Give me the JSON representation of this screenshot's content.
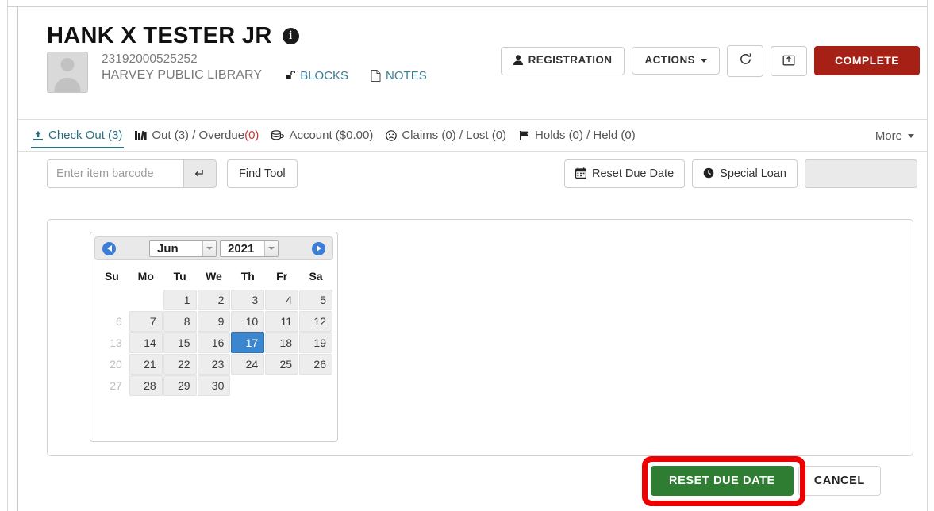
{
  "patron": {
    "name": "HANK X TESTER JR",
    "info_icon": "info-icon",
    "barcode": "23192000525252",
    "library": "HARVEY PUBLIC LIBRARY",
    "blocks_label": "BLOCKS",
    "blocks_icon": "unlock-icon",
    "notes_label": "NOTES",
    "notes_icon": "note-page-icon"
  },
  "header_actions": {
    "registration_label": "REGISTRATION",
    "registration_icon": "person-icon",
    "actions_label": "ACTIONS",
    "actions_caret": "caret-down-icon",
    "refresh_icon": "refresh-icon",
    "refresh_glyph": "↻",
    "popout_icon": "pop-out-icon",
    "complete_label": "COMPLETE",
    "complete_color": "#a72015"
  },
  "tabs": [
    {
      "label": "Check Out (3)",
      "icon": "check-out-upload-icon",
      "glyph": "⤒",
      "active": true
    },
    {
      "label": "Out (3) / Overdue ",
      "suffix": "(0)",
      "icon": "books-icon",
      "glyph": "‖",
      "active": false
    },
    {
      "label": "Account ($0.00)",
      "icon": "money-stack-icon",
      "glyph": "Ⓢ",
      "active": false
    },
    {
      "label": "Claims (0) / Lost (0)",
      "icon": "face-frown-icon",
      "glyph": "☹",
      "active": false
    },
    {
      "label": "Holds (0) / Held (0)",
      "icon": "flag-icon",
      "glyph": "⚑",
      "active": false
    }
  ],
  "tab_more_label": "More",
  "toolbar": {
    "barcode_placeholder": "Enter item barcode",
    "barcode_value": "",
    "submit_icon": "enter-arrow-icon",
    "submit_glyph": "↵",
    "find_tool_label": "Find Tool",
    "reset_due_date_label": "Reset Due Date",
    "reset_due_date_icon": "calendar-icon",
    "special_loan_label": "Special Loan",
    "special_loan_icon": "clock-icon",
    "extra_field_value": ""
  },
  "datepicker": {
    "prev_icon": "prev-month-arrow-icon",
    "next_icon": "next-month-arrow-icon",
    "month": "Jun",
    "year": "2021",
    "weekdays": [
      "Su",
      "Mo",
      "Tu",
      "We",
      "Th",
      "Fr",
      "Sa"
    ],
    "selected_day": 17,
    "selected_color": "#3a87cf",
    "weeks": [
      [
        {
          "d": "",
          "st": "empty"
        },
        {
          "d": "",
          "st": "empty"
        },
        {
          "d": "1",
          "st": "on"
        },
        {
          "d": "2",
          "st": "on"
        },
        {
          "d": "3",
          "st": "on"
        },
        {
          "d": "4",
          "st": "on"
        },
        {
          "d": "5",
          "st": "on"
        }
      ],
      [
        {
          "d": "6",
          "st": "disabled"
        },
        {
          "d": "7",
          "st": "on"
        },
        {
          "d": "8",
          "st": "on"
        },
        {
          "d": "9",
          "st": "on"
        },
        {
          "d": "10",
          "st": "on"
        },
        {
          "d": "11",
          "st": "on"
        },
        {
          "d": "12",
          "st": "on"
        }
      ],
      [
        {
          "d": "13",
          "st": "disabled"
        },
        {
          "d": "14",
          "st": "on"
        },
        {
          "d": "15",
          "st": "on"
        },
        {
          "d": "16",
          "st": "on"
        },
        {
          "d": "17",
          "st": "selected"
        },
        {
          "d": "18",
          "st": "on"
        },
        {
          "d": "19",
          "st": "on"
        }
      ],
      [
        {
          "d": "20",
          "st": "disabled"
        },
        {
          "d": "21",
          "st": "on"
        },
        {
          "d": "22",
          "st": "on"
        },
        {
          "d": "23",
          "st": "on"
        },
        {
          "d": "24",
          "st": "on"
        },
        {
          "d": "25",
          "st": "on"
        },
        {
          "d": "26",
          "st": "on"
        }
      ],
      [
        {
          "d": "27",
          "st": "disabled"
        },
        {
          "d": "28",
          "st": "on"
        },
        {
          "d": "29",
          "st": "on"
        },
        {
          "d": "30",
          "st": "on"
        },
        {
          "d": "",
          "st": "empty"
        },
        {
          "d": "",
          "st": "empty"
        },
        {
          "d": "",
          "st": "empty"
        }
      ]
    ]
  },
  "dialog_actions": {
    "confirm_label": "RESET DUE DATE",
    "confirm_color": "#2e7d32",
    "cancel_label": "CANCEL",
    "highlight_color": "#ef0000"
  }
}
